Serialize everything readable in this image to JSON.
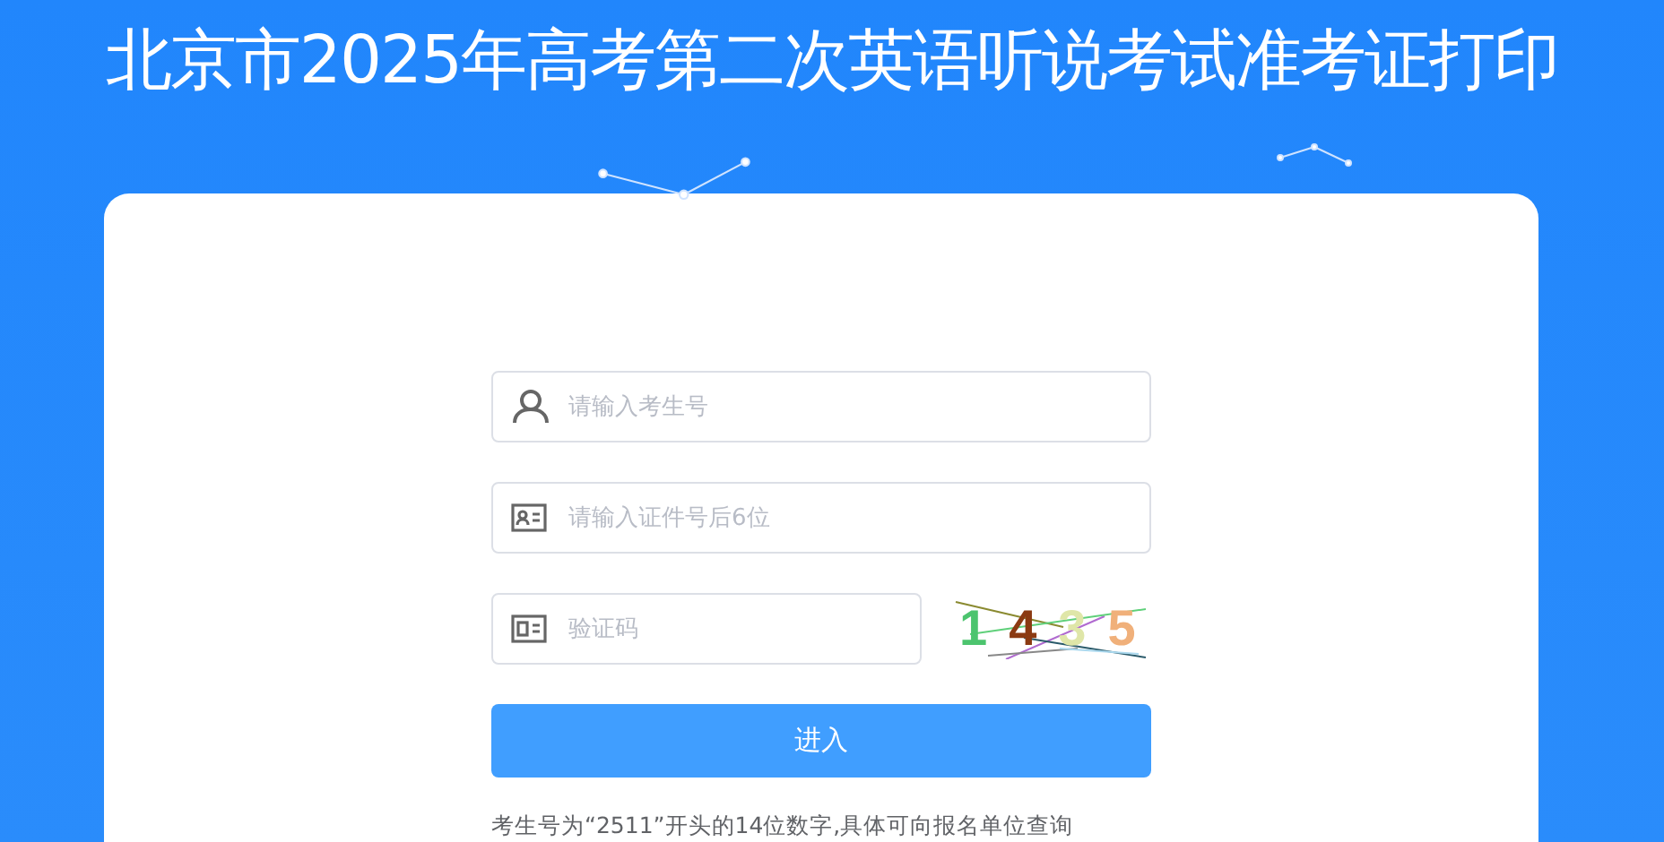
{
  "title": "北京市2025年高考第二次英语听说考试准考证打印",
  "fields": [
    {
      "kind": "user",
      "placeholder": "请输入考生号"
    },
    {
      "kind": "id",
      "placeholder": "请输入证件号后6位"
    }
  ],
  "captcha_field": {
    "placeholder": "验证码"
  },
  "captcha": [
    {
      "digit": "1",
      "color": "#4cc46e"
    },
    {
      "digit": "4",
      "color": "#8b3a12"
    },
    {
      "digit": "3",
      "color": "#dfe6a8"
    },
    {
      "digit": "5",
      "color": "#f0b07a"
    }
  ],
  "submit_button": "进入",
  "note": "考生号为“2511”开头的14位数字,具体可向报名单位查询"
}
